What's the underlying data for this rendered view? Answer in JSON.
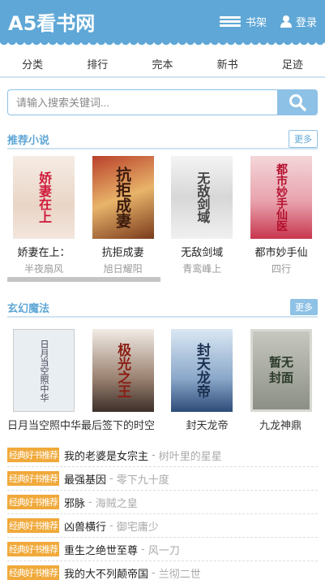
{
  "header": {
    "logo": "A5看书网",
    "shelf_label": "书架",
    "login_label": "登录"
  },
  "nav": [
    "分类",
    "排行",
    "完本",
    "新书",
    "足迹"
  ],
  "search": {
    "placeholder": "请输入搜索关键词..."
  },
  "recommend": {
    "title": "推荐小说",
    "more": "更多",
    "books": [
      {
        "name": "娇妻在上：",
        "author": "半夜扇风",
        "cover_text": "娇妻在上"
      },
      {
        "name": "抗拒成妻",
        "author": "旭日耀阳",
        "cover_text": "抗拒成妻"
      },
      {
        "name": "无敌剑域",
        "author": "青鸾峰上",
        "cover_text": "无敌剑域"
      },
      {
        "name": "都市妙手仙",
        "author": "四行",
        "cover_text": "都市妙手仙医"
      }
    ]
  },
  "fantasy": {
    "title": "玄幻魔法",
    "more": "更多",
    "books": [
      {
        "name": "日月当空照",
        "cover_text": "日月当空照中华"
      },
      {
        "name": "中华最后签下的时空",
        "cover_text": "极光之王"
      },
      {
        "name": "封天龙帝",
        "cover_text": "封天龙帝"
      },
      {
        "name": "九龙神鼎",
        "cover_text": "暂无封面"
      }
    ],
    "list_tag": "经典好书推荐",
    "list": [
      {
        "title": "我的老婆是女宗主",
        "author": "树叶里的星星"
      },
      {
        "title": "最强基因",
        "author": "零下九十度"
      },
      {
        "title": "邪脉",
        "author": "海贼之皇"
      },
      {
        "title": "凶兽横行",
        "author": "御宅庸少"
      },
      {
        "title": "重生之绝世至尊",
        "author": "风一刀"
      },
      {
        "title": "我的大不列颠帝国",
        "author": "兰彻二世"
      }
    ]
  }
}
